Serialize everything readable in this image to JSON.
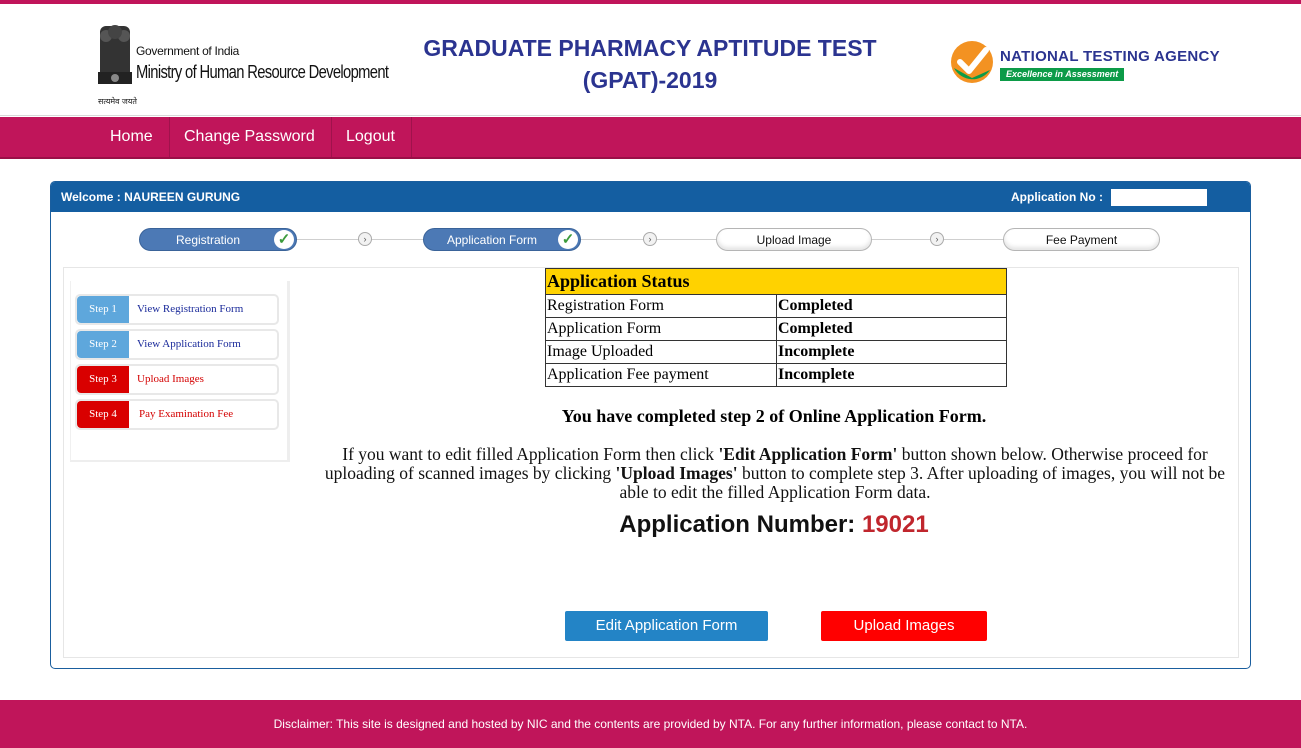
{
  "header": {
    "gov_line": "Government of India",
    "ministry_line": "Ministry of Human Resource Development",
    "emblem_caption": "सत्यमेव जयते",
    "title_line1": "GRADUATE PHARMACY APTITUDE TEST",
    "title_line2": "(GPAT)-2019",
    "nta_name": "NATIONAL TESTING AGENCY",
    "nta_tagline": "Excellence in Assessment"
  },
  "nav": {
    "items": [
      {
        "label": "Home"
      },
      {
        "label": "Change Password"
      },
      {
        "label": "Logout"
      }
    ]
  },
  "panel": {
    "welcome_label": "Welcome :",
    "user_name": "NAUREEN GURUNG",
    "appno_label": "Application No :"
  },
  "progress": {
    "steps": [
      {
        "label": "Registration",
        "done": true
      },
      {
        "label": "Application Form",
        "done": true
      },
      {
        "label": "Upload Image",
        "done": false
      },
      {
        "label": "Fee Payment",
        "done": false
      }
    ]
  },
  "sidebar": {
    "items": [
      {
        "step": "Step 1",
        "label": "View Registration Form",
        "status": "done"
      },
      {
        "step": "Step 2",
        "label": "View Application Form",
        "status": "done"
      },
      {
        "step": "Step 3",
        "label": "Upload Images",
        "status": "pending"
      },
      {
        "step": "Step 4",
        "label": "Pay Examination Fee",
        "status": "pending"
      }
    ]
  },
  "status_table": {
    "heading": "Application Status",
    "rows": [
      {
        "item": "Registration Form",
        "status": "Completed"
      },
      {
        "item": "Application Form",
        "status": "Completed"
      },
      {
        "item": "Image Uploaded",
        "status": "Incomplete"
      },
      {
        "item": "Application Fee payment",
        "status": "Incomplete"
      }
    ]
  },
  "message": {
    "completed": "You have completed step 2 of Online Application Form.",
    "info_part1": "If you want to edit filled Application Form then click ",
    "info_bold1": "'Edit Application Form'",
    "info_part2": " button shown below. Otherwise proceed for uploading of scanned images by clicking ",
    "info_bold2": "'Upload Images'",
    "info_part3": " button to complete step 3. After uploading of images, you will not be able to edit the filled Application Form data.",
    "appnum_label": "Application Number: ",
    "appnum_value": "19021"
  },
  "buttons": {
    "edit": "Edit Application Form",
    "upload": "Upload Images"
  },
  "footer": {
    "disclaimer": "Disclaimer: This site is designed and hosted by NIC and the contents are provided by NTA. For any further information, please contact to NTA."
  },
  "colors": {
    "brand": "#c0155a",
    "panel_head": "#145ea1",
    "completed": "#1e7d1e",
    "appnum": "#c0262d"
  }
}
